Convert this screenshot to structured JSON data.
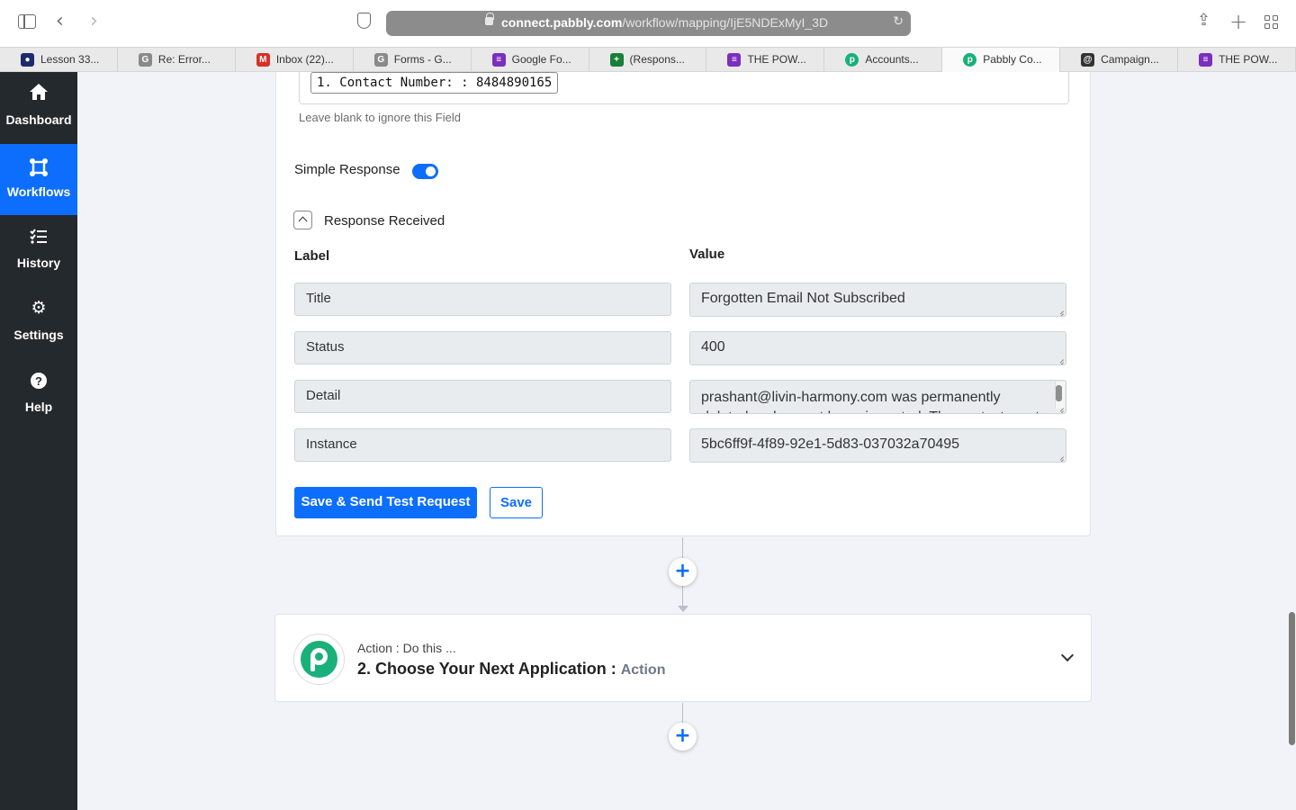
{
  "browser": {
    "url_domain": "connect.pabbly.com",
    "url_path": "/workflow/mapping/IjE5NDExMyI_3D",
    "tabs": [
      {
        "title": "Lesson 33...",
        "color": "#1d2b6b",
        "icon": "lesson-favicon"
      },
      {
        "title": "Re: Error...",
        "color": "#8a8a8a",
        "icon": "g-favicon"
      },
      {
        "title": "Inbox (22)...",
        "color": "#d93025",
        "icon": "gmail-favicon"
      },
      {
        "title": "Forms - G...",
        "color": "#8a8a8a",
        "icon": "g-favicon"
      },
      {
        "title": "Google Fo...",
        "color": "#7b2fbe",
        "icon": "google-forms-favicon"
      },
      {
        "title": "(Respons...",
        "color": "#188038",
        "icon": "google-sheets-favicon"
      },
      {
        "title": "THE POW...",
        "color": "#7b2fbe",
        "icon": "google-forms-favicon"
      },
      {
        "title": "Accounts...",
        "color": "#19b07a",
        "icon": "pabbly-favicon"
      },
      {
        "title": "Pabbly Co...",
        "color": "#19b07a",
        "icon": "pabbly-favicon",
        "active": true
      },
      {
        "title": "Campaign...",
        "color": "#333333",
        "icon": "mailchimp-favicon"
      },
      {
        "title": "THE POW...",
        "color": "#7b2fbe",
        "icon": "google-forms-favicon"
      }
    ]
  },
  "nav": {
    "items": [
      {
        "label": "Dashboard",
        "icon": "home-icon"
      },
      {
        "label": "Workflows",
        "icon": "workflows-icon",
        "active": true
      },
      {
        "label": "History",
        "icon": "history-list-icon"
      },
      {
        "label": "Settings",
        "icon": "gear-icon"
      },
      {
        "label": "Help",
        "icon": "help-icon"
      }
    ]
  },
  "step": {
    "contact_chip": "1. Contact Number: : 8484890165",
    "hint": "Leave blank to ignore this Field",
    "simple_response_label": "Simple Response",
    "simple_response_on": true,
    "response_title": "Response Received",
    "label_header": "Label",
    "value_header": "Value",
    "rows": [
      {
        "label": "Title",
        "value": "Forgotten Email Not Subscribed"
      },
      {
        "label": "Status",
        "value": "400"
      },
      {
        "label": "Detail",
        "value": "prashant@livin-harmony.com was permanently deleted and cannot be re-imported. The contact must re-subscribe to get back on the list."
      },
      {
        "label": "Instance",
        "value": "5bc6ff9f-4f89-92e1-5d83-037032a70495"
      }
    ],
    "save_send_label": "Save & Send Test Request",
    "save_label": "Save"
  },
  "action": {
    "kicker": "Action : Do this ...",
    "title": "2. Choose Your Next Application : ",
    "subtitle": "Action"
  },
  "colors": {
    "primary": "#0d6efd",
    "sidebar": "#24292e",
    "pabbly_green": "#19b07a"
  }
}
